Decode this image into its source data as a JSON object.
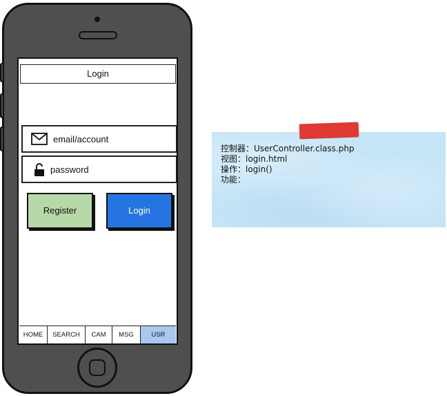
{
  "screen": {
    "title": "Login"
  },
  "form": {
    "email_placeholder": "email/account",
    "password_placeholder": "password",
    "icons": {
      "email": "envelope-icon",
      "password": "unlock-icon"
    }
  },
  "buttons": {
    "register_label": "Register",
    "login_label": "Login"
  },
  "tabbar": {
    "items": [
      {
        "label": "HOME"
      },
      {
        "label": "SEARCH"
      },
      {
        "label": "CAM"
      },
      {
        "label": "MSG"
      },
      {
        "label": "USR",
        "active": true
      }
    ]
  },
  "note": {
    "lines": [
      "控制器：UserController.class.php",
      "视图：login.html",
      "操作：login()",
      "功能："
    ]
  },
  "colors": {
    "phone_body": "#4f4f4f",
    "register_button": "#b7d9a8",
    "login_button": "#2574e2",
    "active_tab": "#a9c8f0",
    "note": "#c5e5f7",
    "tape": "#de3a33"
  }
}
